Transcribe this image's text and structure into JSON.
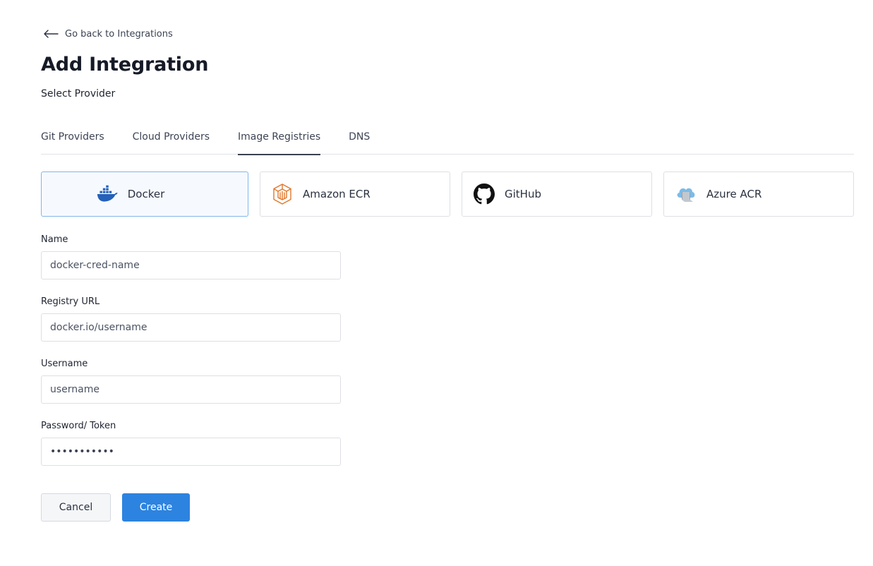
{
  "back_link": {
    "label": "Go back to Integrations",
    "icon": "arrow-left-icon"
  },
  "page_title": "Add Integration",
  "section_label": "Select Provider",
  "tabs": [
    {
      "label": "Git Providers",
      "active": false
    },
    {
      "label": "Cloud Providers",
      "active": false
    },
    {
      "label": "Image Registries",
      "active": true
    },
    {
      "label": "DNS",
      "active": false
    }
  ],
  "providers": [
    {
      "label": "Docker",
      "icon": "docker-icon",
      "selected": true,
      "color": "#2560ba"
    },
    {
      "label": "Amazon ECR",
      "icon": "amazon-ecr-icon",
      "selected": false,
      "color": "#e0772a"
    },
    {
      "label": "GitHub",
      "icon": "github-icon",
      "selected": false,
      "color": "#111111"
    },
    {
      "label": "Azure ACR",
      "icon": "azure-acr-icon",
      "selected": false,
      "color": "#5aa6dc"
    }
  ],
  "form": {
    "name": {
      "label": "Name",
      "placeholder": "docker-cred-name"
    },
    "registry_url": {
      "label": "Registry URL",
      "placeholder": "docker.io/username"
    },
    "username": {
      "label": "Username",
      "placeholder": "username"
    },
    "password": {
      "label": "Password/ Token",
      "value": "•••••••••••"
    }
  },
  "actions": {
    "cancel_label": "Cancel",
    "create_label": "Create"
  },
  "colors": {
    "primary": "#2d83e0",
    "selected_border": "#80b6ea"
  }
}
